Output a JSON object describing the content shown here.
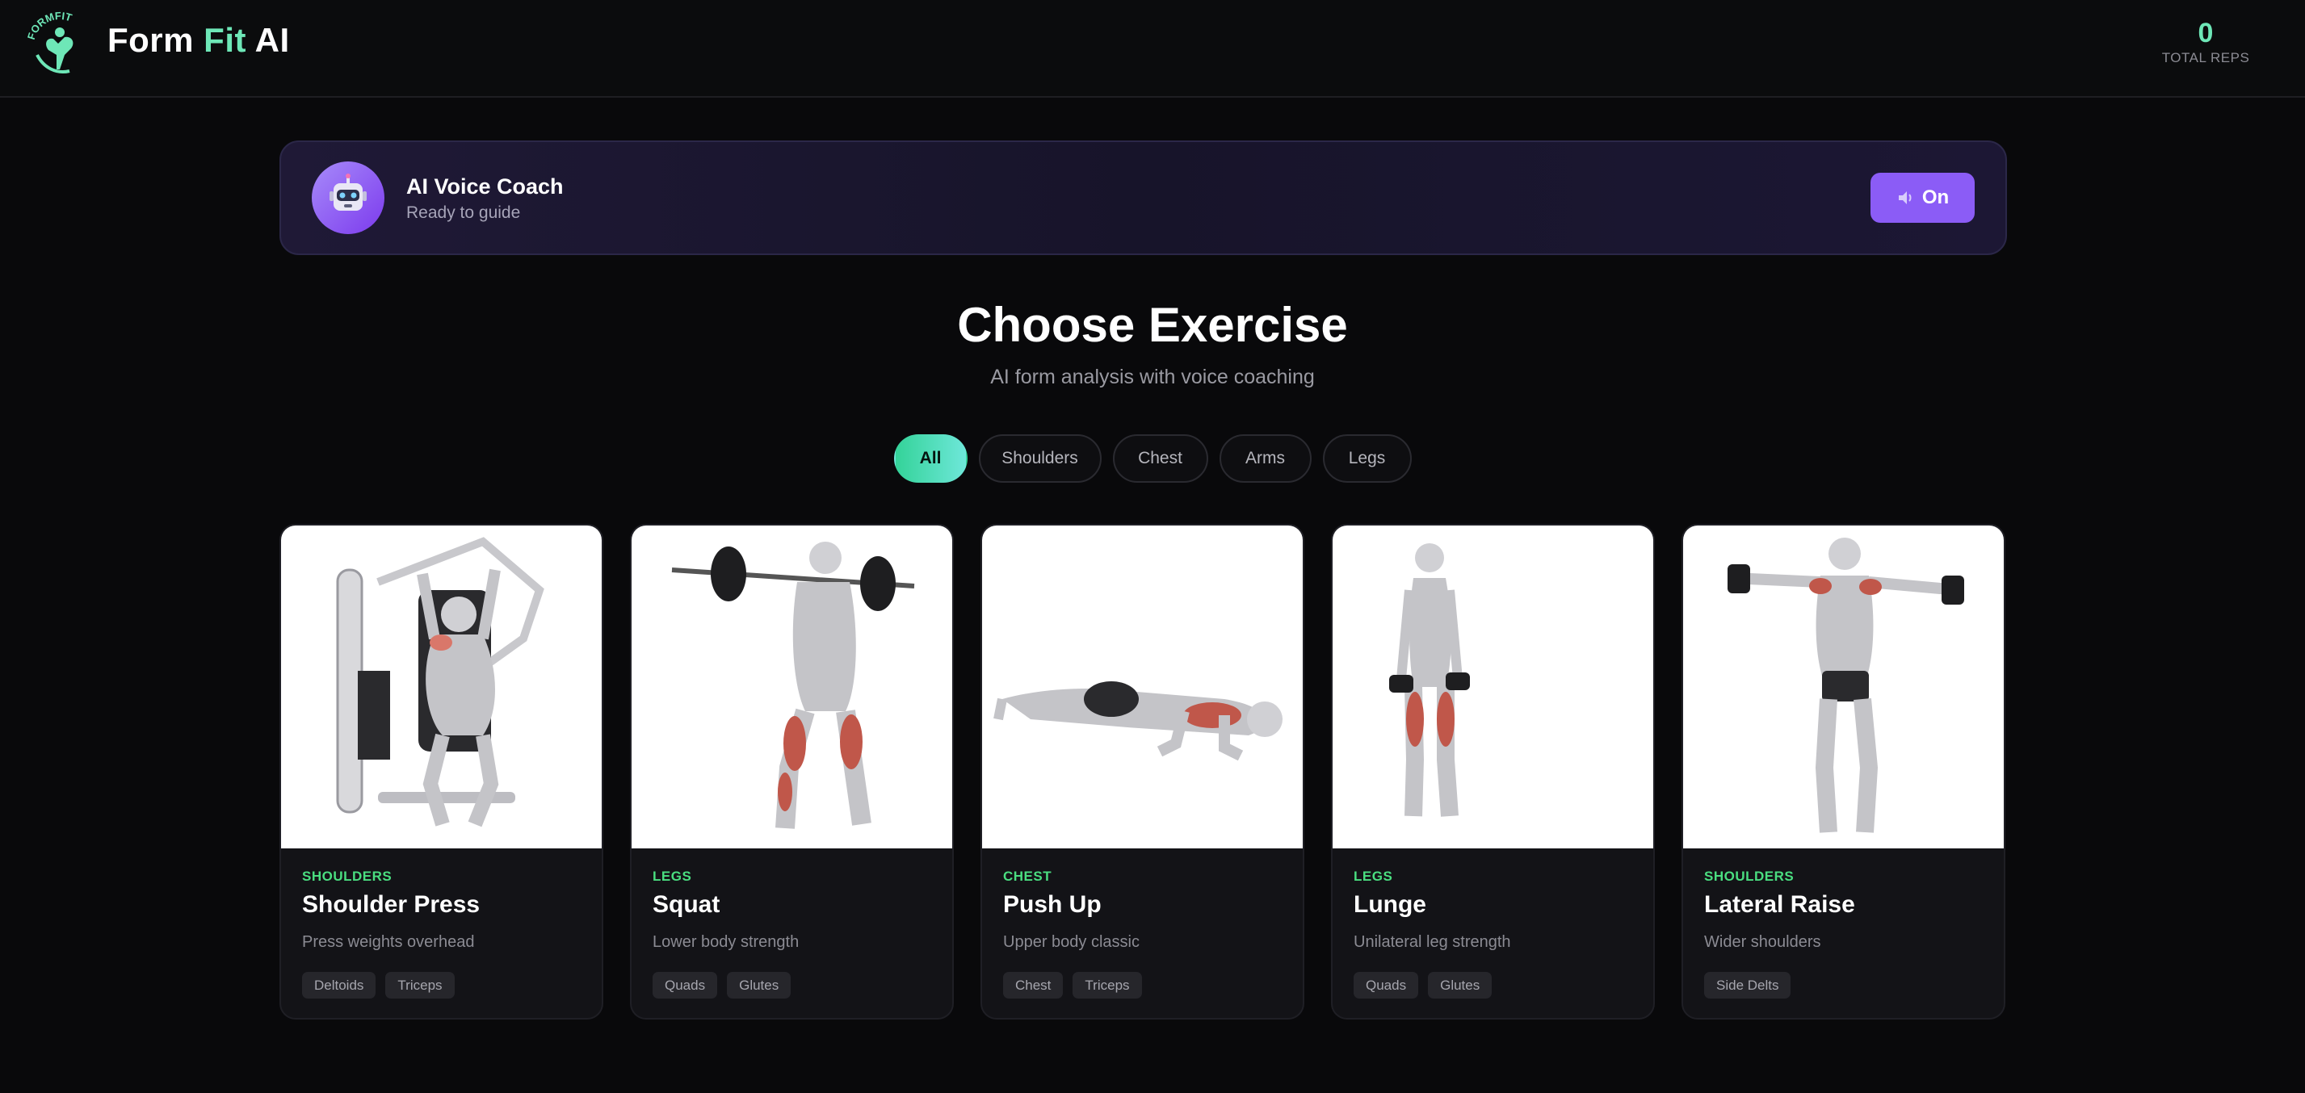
{
  "header": {
    "brand_part1": "Form",
    "brand_part2": "Fit",
    "brand_part3": "AI",
    "logo_text": "FORMFIT",
    "total_reps_value": "0",
    "total_reps_label": "TOTAL REPS"
  },
  "coach": {
    "title": "AI Voice Coach",
    "status": "Ready to guide",
    "toggle_label": "On",
    "icons": {
      "avatar": "robot-icon",
      "toggle": "speaker-icon"
    }
  },
  "main": {
    "title": "Choose Exercise",
    "subtitle": "AI form analysis with voice coaching"
  },
  "filters": [
    {
      "label": "All",
      "active": true
    },
    {
      "label": "Shoulders",
      "active": false
    },
    {
      "label": "Chest",
      "active": false
    },
    {
      "label": "Arms",
      "active": false
    },
    {
      "label": "Legs",
      "active": false
    }
  ],
  "exercises": [
    {
      "category": "SHOULDERS",
      "name": "Shoulder Press",
      "description": "Press weights overhead",
      "tags": [
        "Deltoids",
        "Triceps"
      ]
    },
    {
      "category": "LEGS",
      "name": "Squat",
      "description": "Lower body strength",
      "tags": [
        "Quads",
        "Glutes"
      ]
    },
    {
      "category": "CHEST",
      "name": "Push Up",
      "description": "Upper body classic",
      "tags": [
        "Chest",
        "Triceps"
      ]
    },
    {
      "category": "LEGS",
      "name": "Lunge",
      "description": "Unilateral leg strength",
      "tags": [
        "Quads",
        "Glutes"
      ]
    },
    {
      "category": "SHOULDERS",
      "name": "Lateral Raise",
      "description": "Wider shoulders",
      "tags": [
        "Side Delts"
      ]
    }
  ],
  "colors": {
    "background": "#09090b",
    "accent_green": "#6ee7b7",
    "category_green": "#4ade80",
    "coach_button": "#8b5cf6"
  }
}
